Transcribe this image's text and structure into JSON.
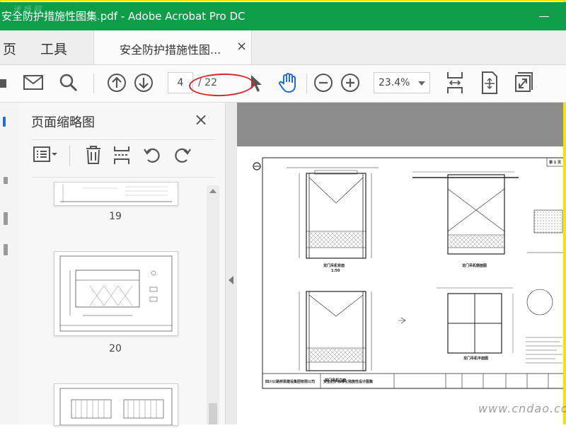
{
  "window": {
    "title": "安全防护措施性图集.pdf - Adobe Acrobat Pro DC",
    "watermark": "送 扬 网"
  },
  "tabs": {
    "home": "页",
    "tools": "工具",
    "document": "安全防护措施性图...",
    "close": "×"
  },
  "toolbar": {
    "page_current": "4",
    "page_total": "/ 22",
    "zoom": "23.4%",
    "icons": [
      "print-icon",
      "mail-icon",
      "search-icon",
      "arrow-up-circle-icon",
      "arrow-down-circle-icon",
      "pointer-icon",
      "hand-icon",
      "zoom-out-icon",
      "zoom-in-icon",
      "fit-width-icon",
      "fit-page-icon",
      "fullscreen-icon"
    ]
  },
  "annotation": {
    "color": "#d22b2b"
  },
  "sidebar": {
    "title": "页面缩略图",
    "close": "×",
    "thumbnails": [
      {
        "number": "19"
      },
      {
        "number": "20"
      },
      {
        "number": ""
      }
    ]
  },
  "document": {
    "labels": {
      "front_view_1": "龙门吊机背面",
      "side_view": "龙门吊机侧面图",
      "front_view_2": "龙门吊机立面",
      "plan_view": "龙门吊机平面图",
      "scale": "1:50",
      "company": "四川公路桥梁建设集团有限公司",
      "atlas": "安全防护标准化措施性设计图集",
      "page_label": "第 1 页"
    }
  },
  "stamp": "www.cndao.com",
  "colors": {
    "titlebar": "#0f9d4a",
    "frame": "#f2e600",
    "doc_bg": "#8c8c8c"
  }
}
